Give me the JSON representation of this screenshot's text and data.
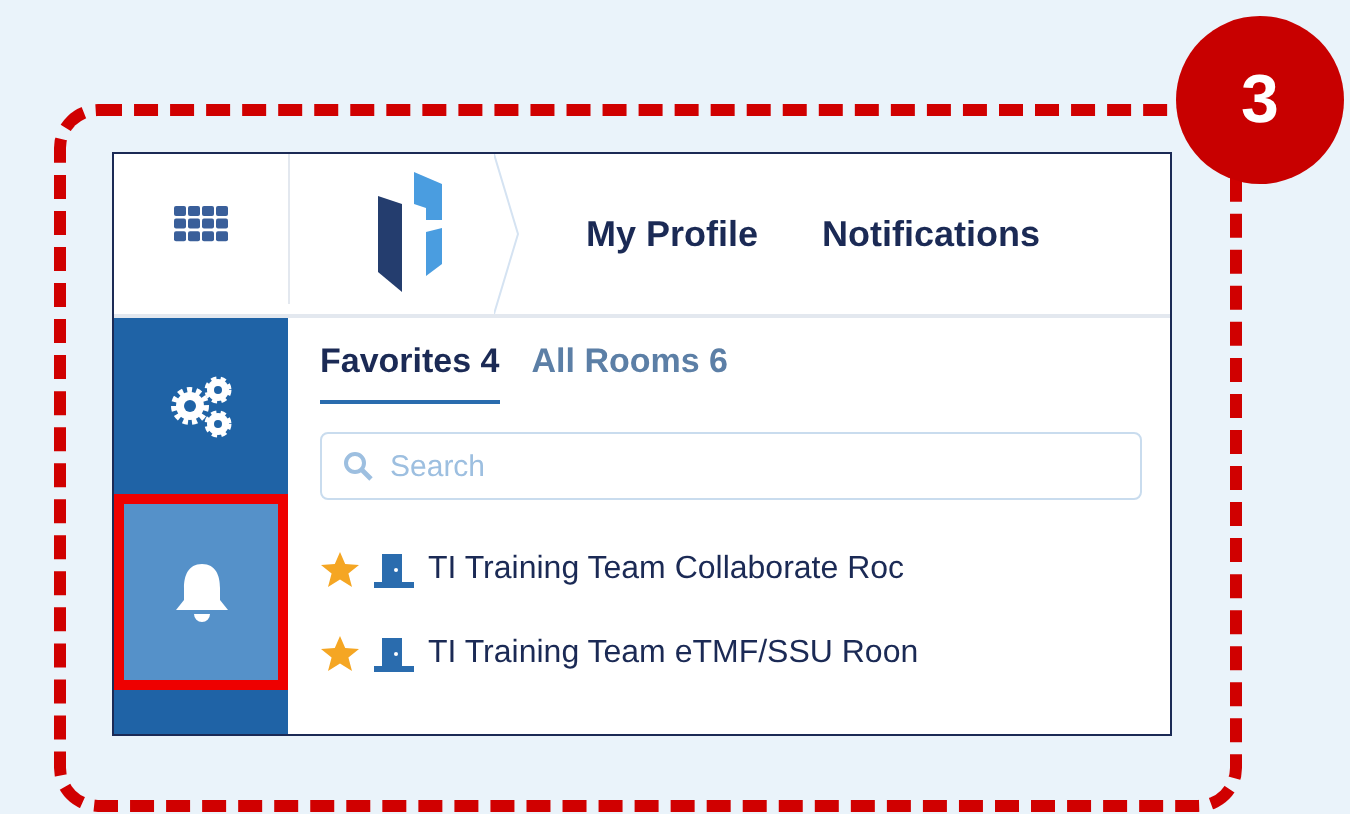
{
  "step_badge": "3",
  "header": {
    "nav": [
      {
        "label": "My Profile"
      },
      {
        "label": "Notifications"
      }
    ]
  },
  "sidebar": {
    "items": [
      {
        "kind": "gears",
        "selected": false,
        "highlighted": false
      },
      {
        "kind": "bell",
        "selected": true,
        "highlighted": true
      }
    ]
  },
  "tabs": [
    {
      "label": "Favorites 4",
      "selected": true
    },
    {
      "label": "All Rooms 6",
      "selected": false
    }
  ],
  "search": {
    "placeholder": "Search"
  },
  "rooms": [
    {
      "name": "TI Training Team Collaborate Roc"
    },
    {
      "name": "TI Training Team eTMF/SSU Roon"
    }
  ]
}
